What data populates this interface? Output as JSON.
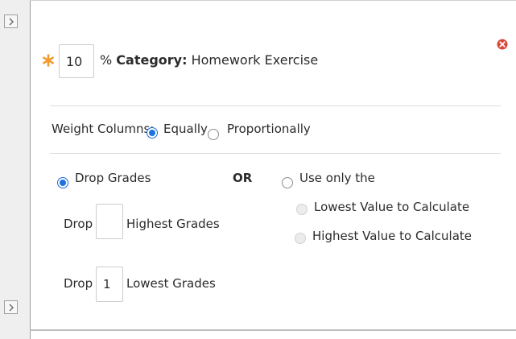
{
  "category": {
    "weight_value": "10",
    "percent_prefix": "%",
    "category_label": "Category:",
    "category_name": "Homework Exercise"
  },
  "weight_columns": {
    "label": "Weight Columns:",
    "options": [
      "Equally",
      "Proportionally"
    ],
    "selected": "Equally"
  },
  "drop": {
    "drop_grades_label": "Drop Grades",
    "or_label": "OR",
    "use_only_label": "Use only the",
    "lowest_value_label": "Lowest Value to Calculate",
    "highest_value_label": "Highest Value to Calculate",
    "drop_word": "Drop",
    "highest_grades_label": "Highest Grades",
    "highest_value": "",
    "lowest_grades_label": "Lowest Grades",
    "lowest_value": "1"
  },
  "colors": {
    "accent": "#1e73e0",
    "required_star": "#f29a2e",
    "remove_icon": "#d8473a"
  },
  "icons": [
    "expand-arrow-icon",
    "required-star-icon",
    "remove-icon"
  ]
}
